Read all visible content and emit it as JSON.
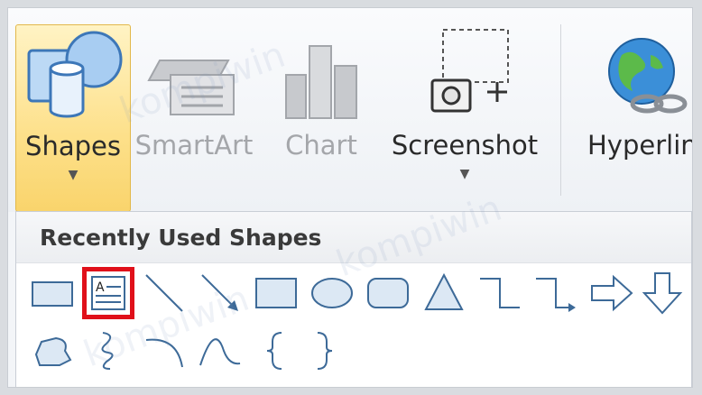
{
  "ribbon": {
    "buttons": [
      {
        "label": "Shapes",
        "icon": "shapes-icon",
        "active": true
      },
      {
        "label": "SmartArt",
        "icon": "smartart-icon",
        "disabled": true
      },
      {
        "label": "Chart",
        "icon": "chart-icon",
        "disabled": true
      },
      {
        "label": "Screenshot",
        "icon": "screenshot-icon"
      },
      {
        "label": "Hyperlin",
        "icon": "hyperlink-icon"
      }
    ]
  },
  "dropdown": {
    "title": "Recently Used Shapes",
    "shapes_row1": [
      "rectangle",
      "text-box",
      "line",
      "arrow",
      "rectangle",
      "oval",
      "rounded-rectangle",
      "triangle",
      "elbow-connector",
      "elbow-arrow-connector",
      "right-arrow",
      "down-arrow"
    ],
    "shapes_row2": [
      "freeform",
      "scribble",
      "arc",
      "curve",
      "left-brace",
      "right-brace"
    ],
    "selected": "text-box"
  },
  "watermark": "kompiwin",
  "colors": {
    "selection": "#e0101a",
    "active_button": "#fde08a"
  }
}
